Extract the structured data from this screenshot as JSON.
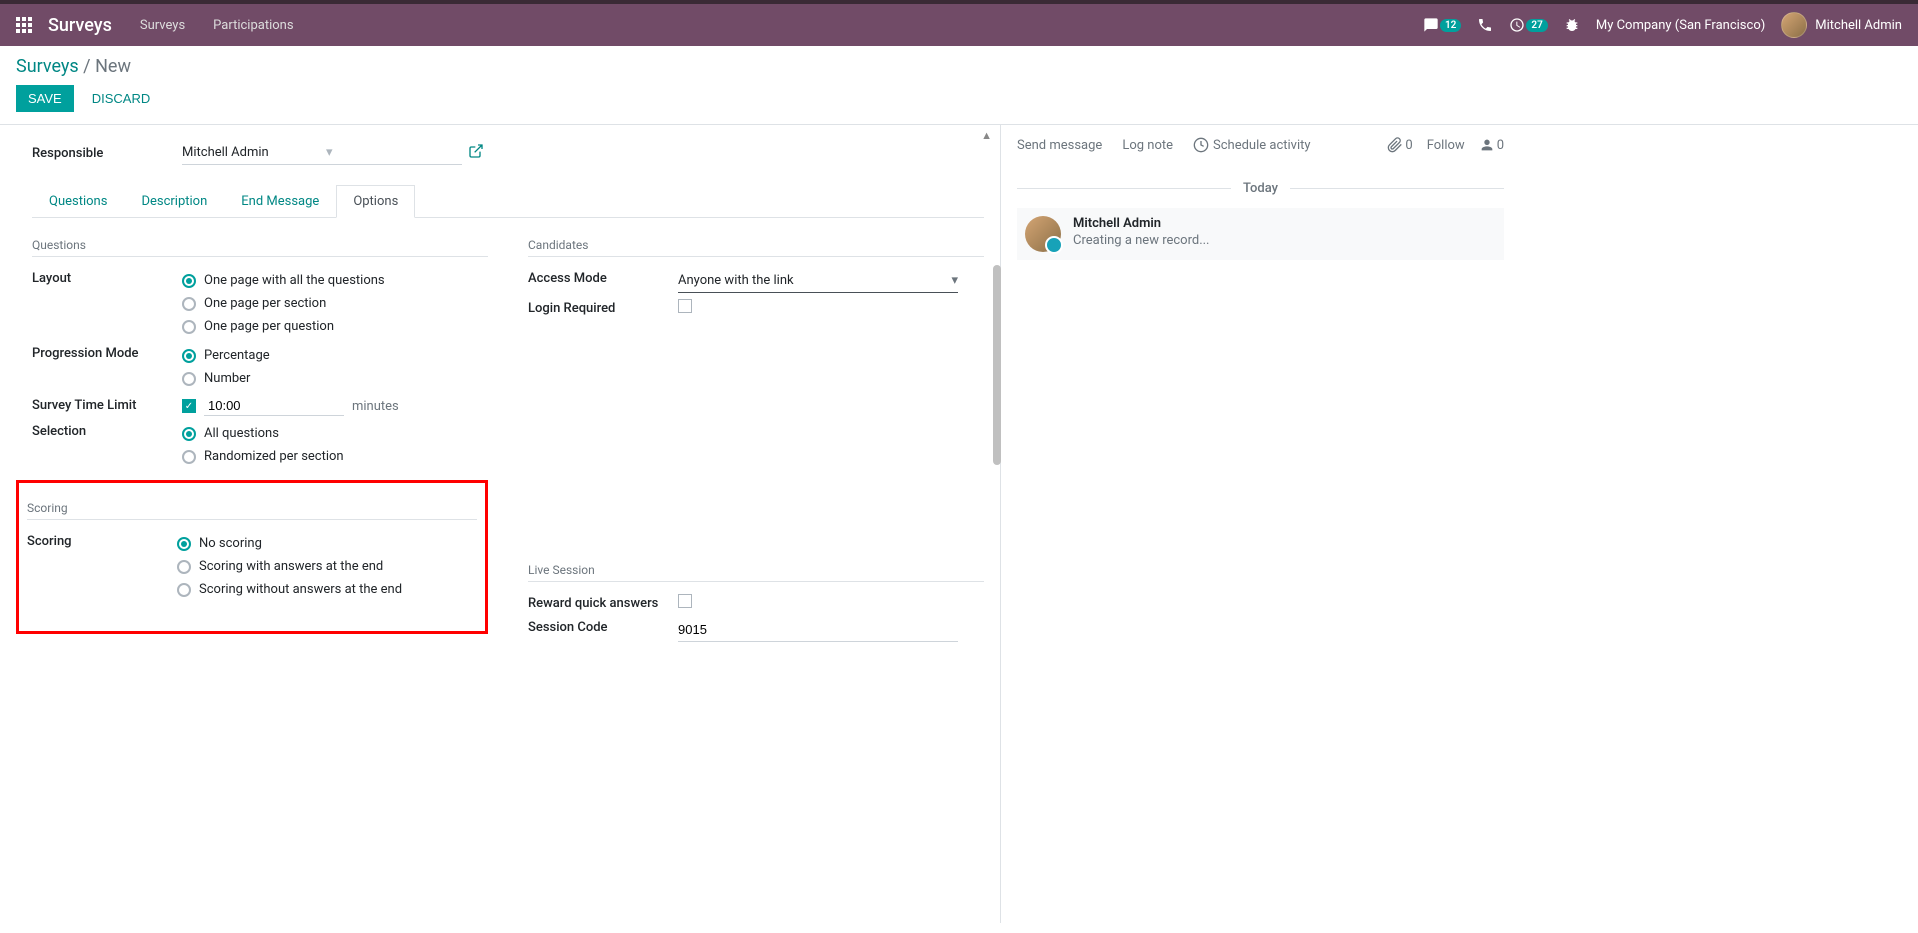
{
  "topbar": {
    "brand": "Surveys",
    "nav": {
      "surveys": "Surveys",
      "participations": "Participations"
    },
    "messages_count": "12",
    "activities_count": "27",
    "company": "My Company (San Francisco)",
    "user": "Mitchell Admin"
  },
  "breadcrumb": {
    "parent": "Surveys",
    "current": "New"
  },
  "actions": {
    "save": "SAVE",
    "discard": "DISCARD"
  },
  "form": {
    "responsible_label": "Responsible",
    "responsible_value": "Mitchell Admin"
  },
  "tabs": {
    "questions": "Questions",
    "description": "Description",
    "end_message": "End Message",
    "options": "Options"
  },
  "options": {
    "questions_heading": "Questions",
    "layout_label": "Layout",
    "layout_opts": {
      "all": "One page with all the questions",
      "section": "One page per section",
      "question": "One page per question"
    },
    "progression_label": "Progression Mode",
    "progression_opts": {
      "percentage": "Percentage",
      "number": "Number"
    },
    "time_limit_label": "Survey Time Limit",
    "time_limit_value": "10:00",
    "time_limit_unit": "minutes",
    "selection_label": "Selection",
    "selection_opts": {
      "all": "All questions",
      "random": "Randomized per section"
    },
    "scoring_heading": "Scoring",
    "scoring_label": "Scoring",
    "scoring_opts": {
      "none": "No scoring",
      "with": "Scoring with answers at the end",
      "without": "Scoring without answers at the end"
    },
    "candidates_heading": "Candidates",
    "access_label": "Access Mode",
    "access_value": "Anyone with the link",
    "login_label": "Login Required",
    "live_heading": "Live Session",
    "reward_label": "Reward quick answers",
    "session_label": "Session Code",
    "session_value": "9015"
  },
  "chatter": {
    "send": "Send message",
    "log": "Log note",
    "schedule": "Schedule activity",
    "attachments": "0",
    "follow": "Follow",
    "followers": "0",
    "separator": "Today",
    "msg_author": "Mitchell Admin",
    "msg_body": "Creating a new record..."
  }
}
